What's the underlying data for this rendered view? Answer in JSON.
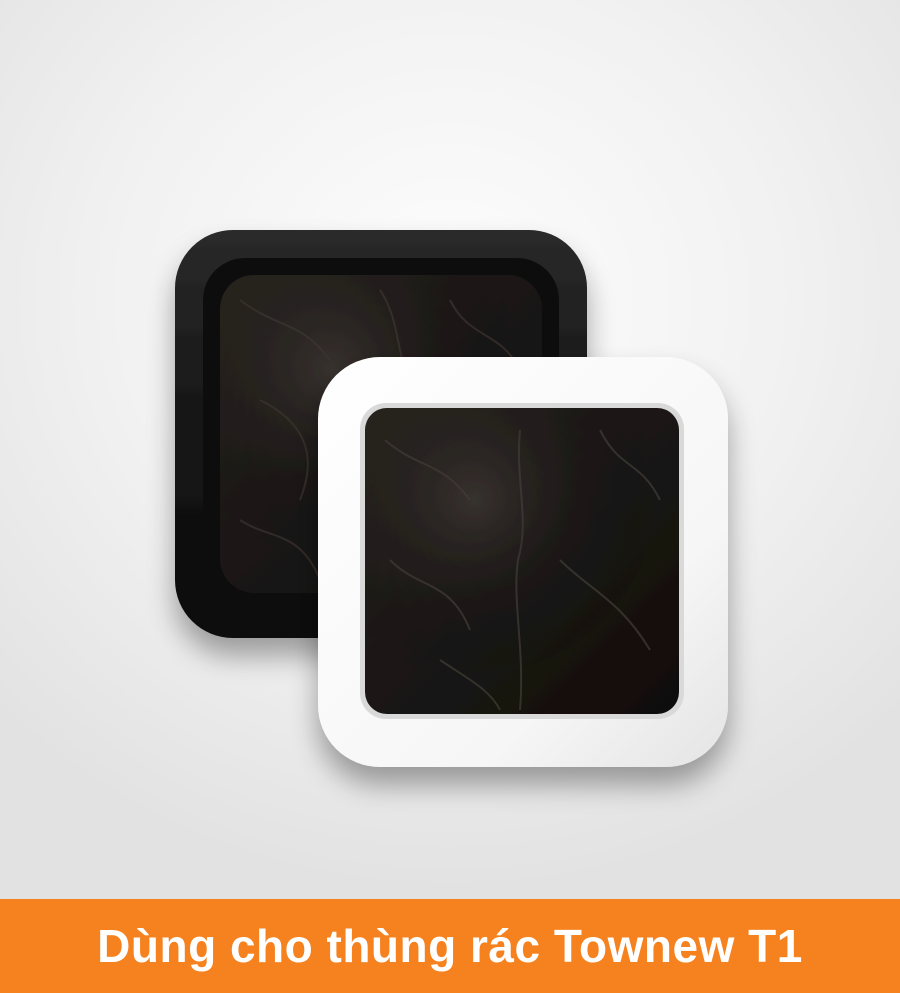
{
  "scene": {
    "alt": "Two square refill cartridges of black garbage bags, one with black frame and one with white frame",
    "back_frame_color": "#1a1a1a",
    "front_frame_color": "#ffffff",
    "bag_color": "#1c1816"
  },
  "banner": {
    "text": "Dùng cho thùng rác Townew T1",
    "background_color": "#f5821f",
    "text_color": "#ffffff"
  }
}
